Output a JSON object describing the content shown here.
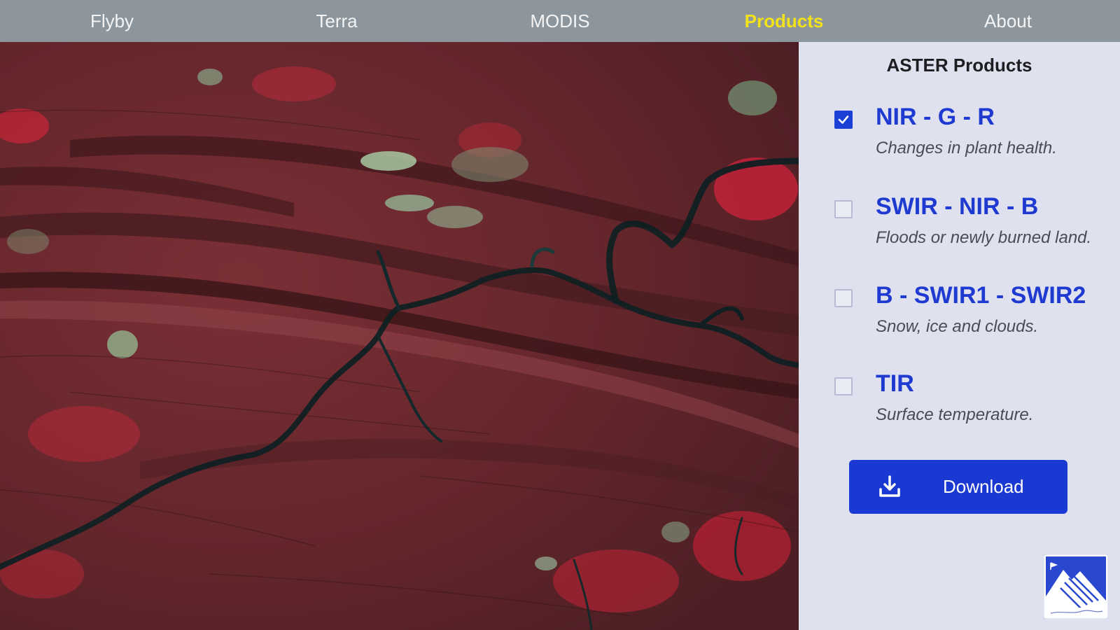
{
  "nav": {
    "items": [
      {
        "label": "Flyby",
        "active": false
      },
      {
        "label": "Terra",
        "active": false
      },
      {
        "label": "MODIS",
        "active": false
      },
      {
        "label": "Products",
        "active": true
      },
      {
        "label": "About",
        "active": false
      }
    ],
    "active_color": "#f2e21a",
    "background": "#8d969d"
  },
  "map": {
    "image": "ASTER false-color satellite scene (red vegetation, dark river network)"
  },
  "sidebar": {
    "title": "ASTER Products",
    "products": [
      {
        "name": "NIR - G - R",
        "description": "Changes in plant health.",
        "checked": true
      },
      {
        "name": "SWIR - NIR - B",
        "description": "Floods or newly burned land.",
        "checked": false
      },
      {
        "name": "B - SWIR1 - SWIR2",
        "description": "Snow, ice and clouds.",
        "checked": false
      },
      {
        "name": "TIR",
        "description": "Surface temperature.",
        "checked": false
      }
    ],
    "download_label": "Download",
    "download_icon": "download-icon",
    "accent_color": "#1a38d2"
  }
}
